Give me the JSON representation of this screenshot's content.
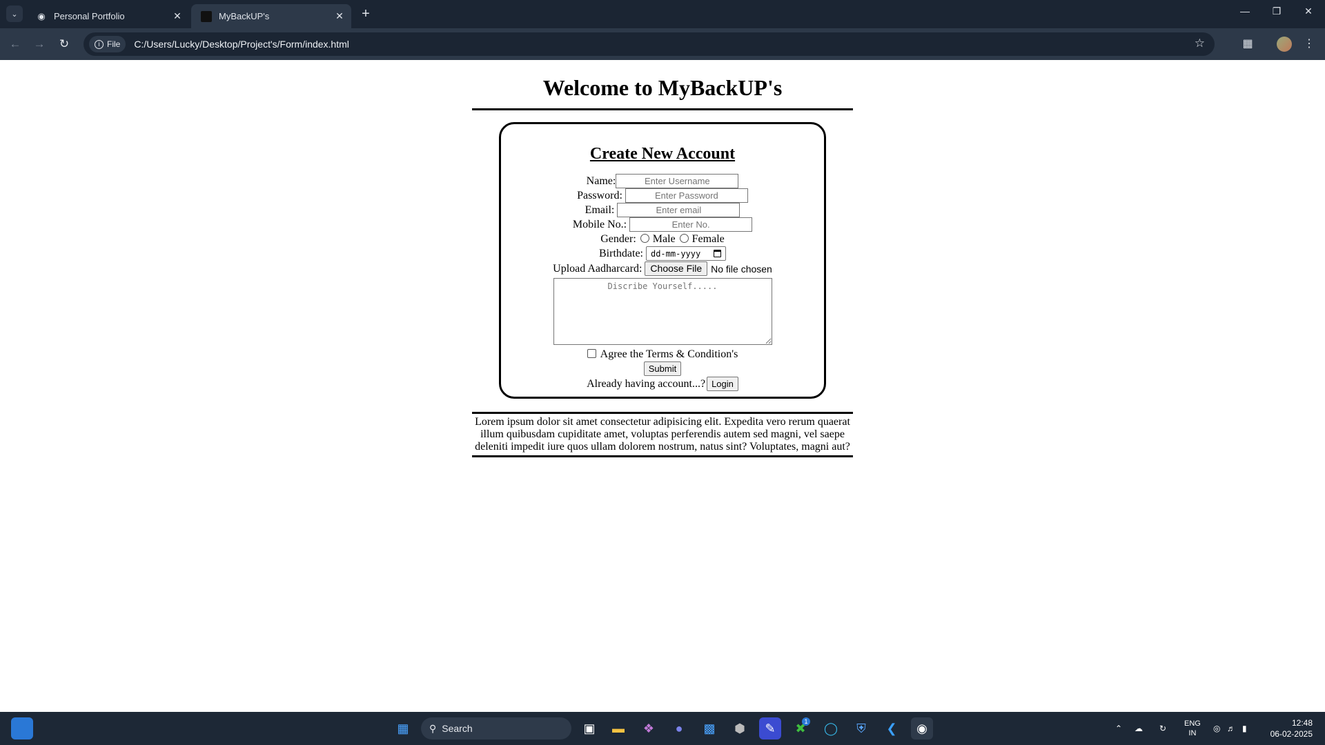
{
  "browser": {
    "tabs": [
      {
        "title": "Personal Portfolio"
      },
      {
        "title": "MyBackUP's"
      }
    ],
    "omnibox": {
      "chip": "File",
      "url": "C:/Users/Lucky/Desktop/Project's/Form/index.html"
    }
  },
  "page": {
    "heading": "Welcome to MyBackUP's",
    "form": {
      "title": "Create New Account",
      "name_label": "Name:",
      "name_placeholder": "Enter Username",
      "password_label": "Password:",
      "password_placeholder": "Enter Password",
      "email_label": "Email:",
      "email_placeholder": "Enter email",
      "mobile_label": "Mobile No.:",
      "mobile_placeholder": "Enter No.",
      "gender_label": "Gender:",
      "gender_male": "Male",
      "gender_female": "Female",
      "birthdate_label": "Birthdate:",
      "birthdate_placeholder": "dd-mm-yyyy",
      "upload_label": "Upload Aadharcard:",
      "choose_file": "Choose File",
      "no_file": "No file chosen",
      "describe_placeholder": "Discribe Yourself.....",
      "terms_label": "Agree the Terms & Condition's",
      "submit": "Submit",
      "already_text": "Already having account...?",
      "login": "Login"
    },
    "footer_text": "Lorem ipsum dolor sit amet consectetur adipisicing elit. Expedita vero rerum quaerat illum quibusdam cupiditate amet, voluptas perferendis autem sed magni, vel saepe deleniti impedit iure quos ullam dolorem nostrum, natus sint? Voluptates, magni aut?"
  },
  "taskbar": {
    "search": "Search",
    "lang_top": "ENG",
    "lang_bottom": "IN",
    "time": "12:48",
    "date": "06-02-2025",
    "xbox_badge": "1"
  }
}
